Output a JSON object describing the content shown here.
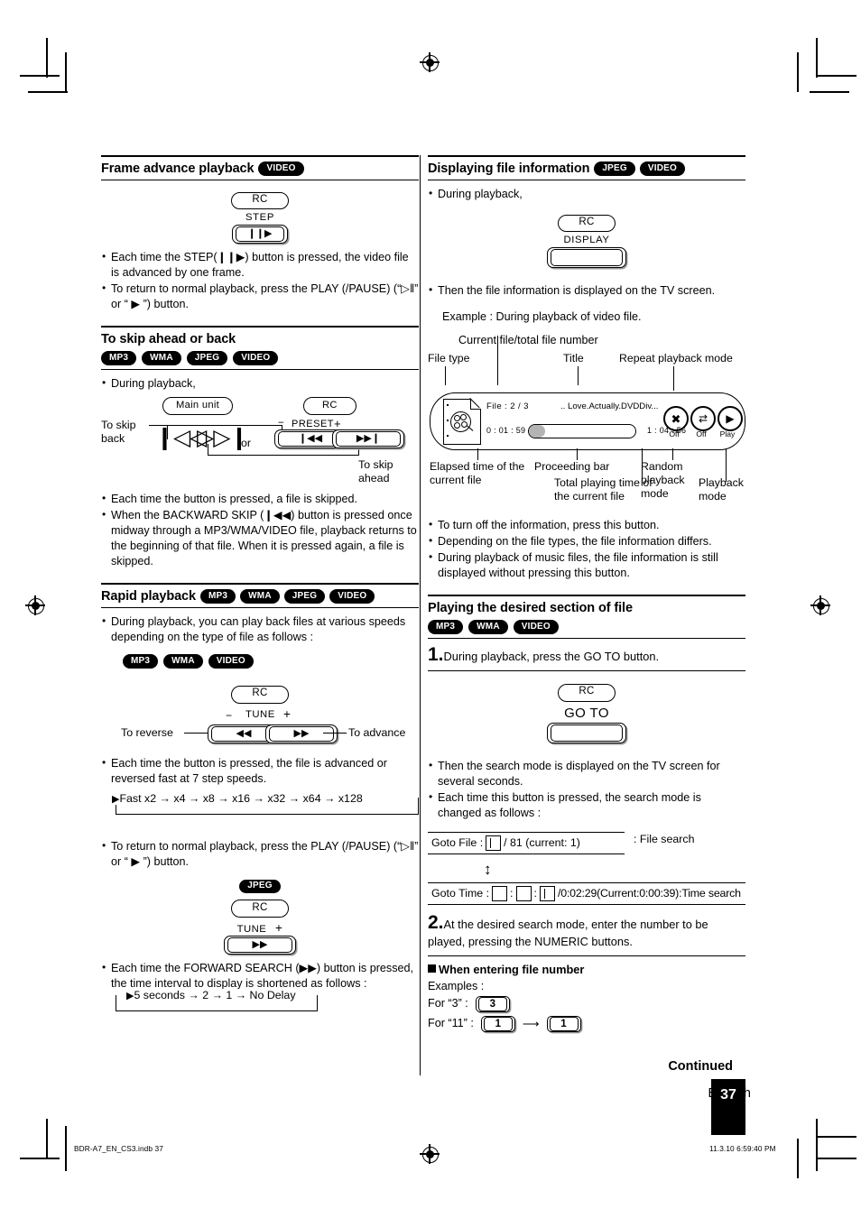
{
  "page": {
    "language": "English",
    "page_number": "37",
    "continued_label": "Continued",
    "footer_left": "BDR-A7_EN_CS3.indb   37",
    "footer_right": "11.3.10   6:59:40 PM"
  },
  "left_column": {
    "frame_advance": {
      "title": "Frame advance playback",
      "badges": [
        "VIDEO"
      ],
      "rc_label": "RC",
      "key_label": "STEP",
      "key_glyph": "❙❙▶",
      "bullets": [
        "Each time the STEP(❙❙▶) button is pressed, the video file is advanced by one frame.",
        "To return to normal playback, press the PLAY (/PAUSE) (“▷‖” or “ ▶ ”) button."
      ]
    },
    "skip": {
      "title": "To skip ahead or back",
      "badges": [
        "MP3",
        "WMA",
        "JPEG",
        "VIDEO"
      ],
      "intro": "During playback,",
      "main_unit_label": "Main unit",
      "rc_label": "RC",
      "preset_minus": "−",
      "preset_label": "PRESET",
      "preset_plus": "+",
      "to_skip_back": "To skip back",
      "to_skip_ahead": "To skip ahead",
      "or_label": "or",
      "main_back_glyph": "❙◁◁",
      "main_fwd_glyph": "▷▷❙",
      "rc_back_glyph": "❙◀◀",
      "rc_fwd_glyph": "▶▶❙",
      "bullets": [
        "Each time the button is pressed, a file is skipped.",
        "When the BACKWARD SKIP (❙◀◀) button is pressed once midway through a MP3/WMA/VIDEO file, playback returns to the beginning of that file. When it is pressed again, a file is skipped."
      ]
    },
    "rapid": {
      "title": "Rapid playback",
      "badges": [
        "MP3",
        "WMA",
        "JPEG",
        "VIDEO"
      ],
      "intro_bullet": "During playback, you can play back files at various speeds depending on the type of file as follows :",
      "group1_badges": [
        "MP3",
        "WMA",
        "VIDEO"
      ],
      "rc_label": "RC",
      "tune_minus": "−",
      "tune_label": "TUNE",
      "tune_plus": "+",
      "to_reverse": "To reverse",
      "to_advance": "To advance",
      "rev_glyph": "◀◀",
      "fwd_glyph": "▶▶",
      "bullet_7step": "Each time the button is pressed, the file is advanced or reversed fast at 7 step speeds.",
      "speed_flow": "Fast x2 → x4 → x8 → x16 → x32 → x64 → x128",
      "bullet_return": "To return to normal playback, press the PLAY (/PAUSE) (“▷‖” or “ ▶ ”) button.",
      "group2_badges": [
        "JPEG"
      ],
      "rc_label2": "RC",
      "tune_label2": "TUNE",
      "tune_plus2": "+",
      "fwd_glyph2": "▶▶",
      "bullet_fwd_search": "Each time the FORWARD SEARCH (▶▶) button is pressed, the time interval to display is shortened as follows :",
      "delay_flow": "5 seconds →  2 → 1 → No Delay"
    }
  },
  "right_column": {
    "display_info": {
      "title": "Displaying file information",
      "badges": [
        "JPEG",
        "VIDEO"
      ],
      "intro_bullet": "During playback,",
      "rc_label": "RC",
      "key_label": "DISPLAY",
      "after_bullet": "Then the file information is displayed on the TV screen.",
      "example_text": "Example : During playback of video file.",
      "callouts": {
        "current_total": "Current file/total file number",
        "file_type": "File type",
        "title": "Title",
        "repeat_mode": "Repeat playback mode",
        "elapsed": "Elapsed time of the current file",
        "proceeding_bar": "Proceeding bar",
        "total_time": "Total playing time of the current file",
        "random_mode": "Random playback mode",
        "playback_mode": "Playback mode"
      },
      "osd": {
        "file_counter": "File : 2 / 3",
        "title_text": ".. Love.Actually.DVDDiv...",
        "elapsed_time": "0 : 01 : 59",
        "total_time": "1 : 04 : 56",
        "random_value": "Off",
        "repeat_value": "Off",
        "play_value": "Play",
        "progress_percent": 15
      },
      "bullets": [
        "To turn off the information, press this button.",
        "Depending on the file types, the file information differs.",
        "During playback of music files, the file information is still displayed without pressing this button."
      ]
    },
    "desired_section": {
      "title": "Playing the desired section of file",
      "badges": [
        "MP3",
        "WMA",
        "VIDEO"
      ],
      "step1_num": "1.",
      "step1_text": "During playback, press the GO TO button.",
      "rc_label": "RC",
      "key_label": "GO TO",
      "bullets": [
        "Then the search mode is displayed on the TV screen for several seconds.",
        "Each time this button is pressed, the search mode is changed as follows :"
      ],
      "goto_file": {
        "prefix": "Goto File :",
        "suffix": "/ 81 (current: 1)",
        "note": ": File search"
      },
      "goto_time": {
        "prefix": "Goto Time :",
        "suffix": "/0:02:29(Current:0:00:39):Time search"
      },
      "step2_num": "2.",
      "step2_text": "At the desired search mode, enter the number to be played, pressing the NUMERIC buttons.",
      "subhead": "When entering file number",
      "examples_label": "Examples :",
      "example1_label": "For “3” :",
      "example1_keys": [
        "3"
      ],
      "example2_label": "For “11” :",
      "example2_keys": [
        "1",
        "1"
      ]
    }
  },
  "colors": {
    "ink": "#000000",
    "paper": "#ffffff",
    "progress_fill": "#b4b4b4",
    "key_shadow": "#9a9a9a"
  }
}
